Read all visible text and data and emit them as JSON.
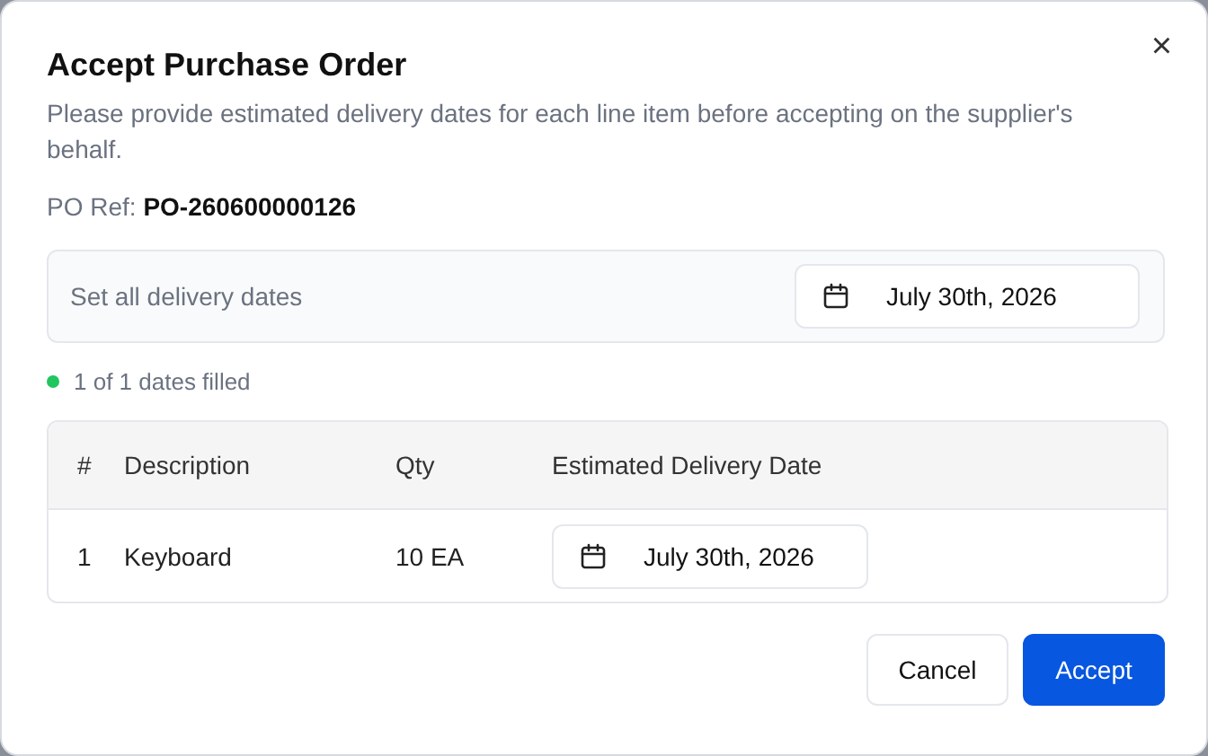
{
  "dialog": {
    "title": "Accept Purchase Order",
    "close_icon": "×",
    "description": "Please provide estimated delivery dates for each line item before accepting on the supplier's behalf.",
    "po_ref": {
      "label": "PO Ref:",
      "value": "PO-260600000126"
    }
  },
  "bulk_date": {
    "label": "Set all delivery dates",
    "value": "July 30th, 2026"
  },
  "status": {
    "text": "1 of 1 dates filled",
    "complete": true
  },
  "table": {
    "columns": [
      "#",
      "Description",
      "Qty",
      "Estimated Delivery Date"
    ],
    "rows": [
      {
        "number": "1",
        "description": "Keyboard",
        "qty": "10 EA",
        "date": "July 30th, 2026"
      }
    ]
  },
  "buttons": [
    {
      "label": "Cancel",
      "kind": "secondary"
    },
    {
      "label": "Accept",
      "kind": "primary"
    }
  ]
}
